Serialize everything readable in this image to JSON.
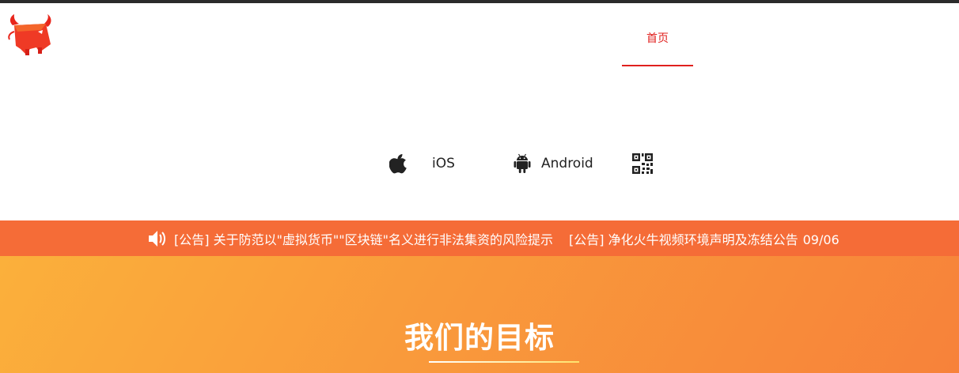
{
  "nav": {
    "items": [
      {
        "label": "首页",
        "active": true
      }
    ],
    "accent_color": "#e0201e"
  },
  "logo": {
    "icon": "red-bull-mascot-logo"
  },
  "downloads": {
    "ios_label": "iOS",
    "android_label": "Android",
    "ios_icon": "apple-icon",
    "android_icon": "android-icon",
    "qr_icon": "qr-code-icon"
  },
  "notice": {
    "icon": "speaker-icon",
    "background": "#f56c37",
    "items": [
      {
        "text": "[公告] 关于防范以\"虚拟货币\"\"区块链\"名义进行非法集资的风险提示",
        "date": ""
      },
      {
        "text": "[公告] 净化火牛视频环境声明及冻结公告",
        "date": "09/06"
      }
    ]
  },
  "hero": {
    "title": "我们的目标",
    "gradient": [
      "#fbb03b",
      "#f7823a"
    ]
  }
}
